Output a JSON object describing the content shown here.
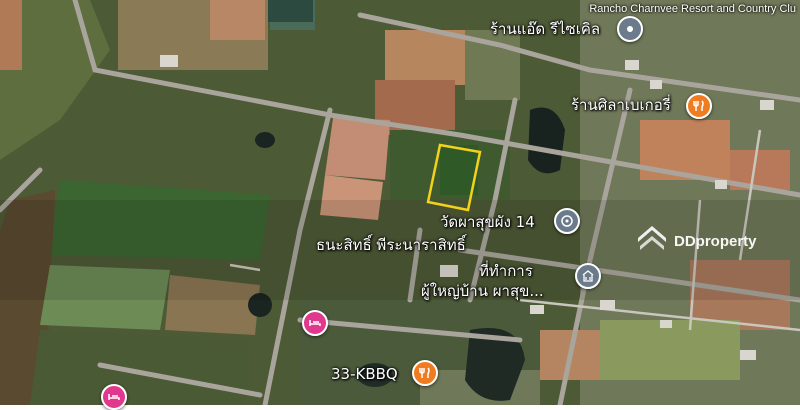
{
  "map": {
    "top_right_place": "Rancho Charnvee Resort and Country Clu",
    "labels": [
      {
        "id": "recycle-shop",
        "text": "ร้านแอ๊ด รีไซเคิล",
        "icon": "map-pin-icon"
      },
      {
        "id": "bakery",
        "text": "ร้านศิลาเบเกอรี่",
        "icon": "restaurant-icon"
      },
      {
        "id": "temple",
        "text": "วัดผาสุขผัง 14",
        "icon": "temple-icon"
      },
      {
        "id": "thanasit",
        "text": "ธนะสิทธิ์ พีระนาราสิทธิ์"
      },
      {
        "id": "office-line1",
        "text": "ที่ทำการ"
      },
      {
        "id": "office-line2",
        "text": "ผู้ใหญ่บ้าน ผาสุข..."
      },
      {
        "id": "kbbq",
        "text": "33-KBBQ",
        "icon": "restaurant-icon"
      }
    ],
    "pin_colors": {
      "restaurant": "#f07c21",
      "hotel": "#e0388d",
      "place": "#6b7b8c"
    }
  },
  "watermark": {
    "text": "DDproperty"
  }
}
